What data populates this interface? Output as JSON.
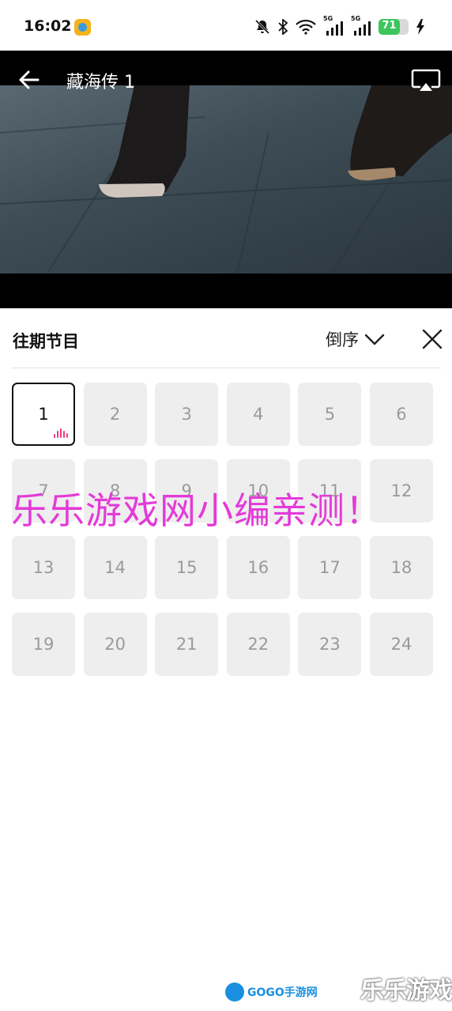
{
  "status_bar": {
    "time": "16:02",
    "battery_level": "71",
    "network_labels": [
      "5G",
      "5G"
    ],
    "icons": [
      "mute-icon",
      "bluetooth-icon",
      "wifi-icon",
      "signal-icon",
      "signal-icon",
      "battery-icon",
      "charging-icon"
    ]
  },
  "player": {
    "title": "藏海传 1",
    "back_icon": "back-arrow-icon",
    "cast_icon": "cast-icon"
  },
  "episodes_panel": {
    "title": "往期节目",
    "sort_label": "倒序",
    "sort_icon": "chevron-down-icon",
    "close_icon": "close-icon",
    "episodes": [
      "1",
      "2",
      "3",
      "4",
      "5",
      "6",
      "7",
      "8",
      "9",
      "10",
      "11",
      "12",
      "13",
      "14",
      "15",
      "16",
      "17",
      "18",
      "19",
      "20",
      "21",
      "22",
      "23",
      "24"
    ],
    "active_episode": "1",
    "accent_color": "#f03c82"
  },
  "watermark": {
    "text": "乐乐游戏网小编亲测！",
    "color": "#e43ad8"
  },
  "footer_logos": {
    "gogo": "GOGO手游网",
    "lele": "乐乐游戏"
  }
}
